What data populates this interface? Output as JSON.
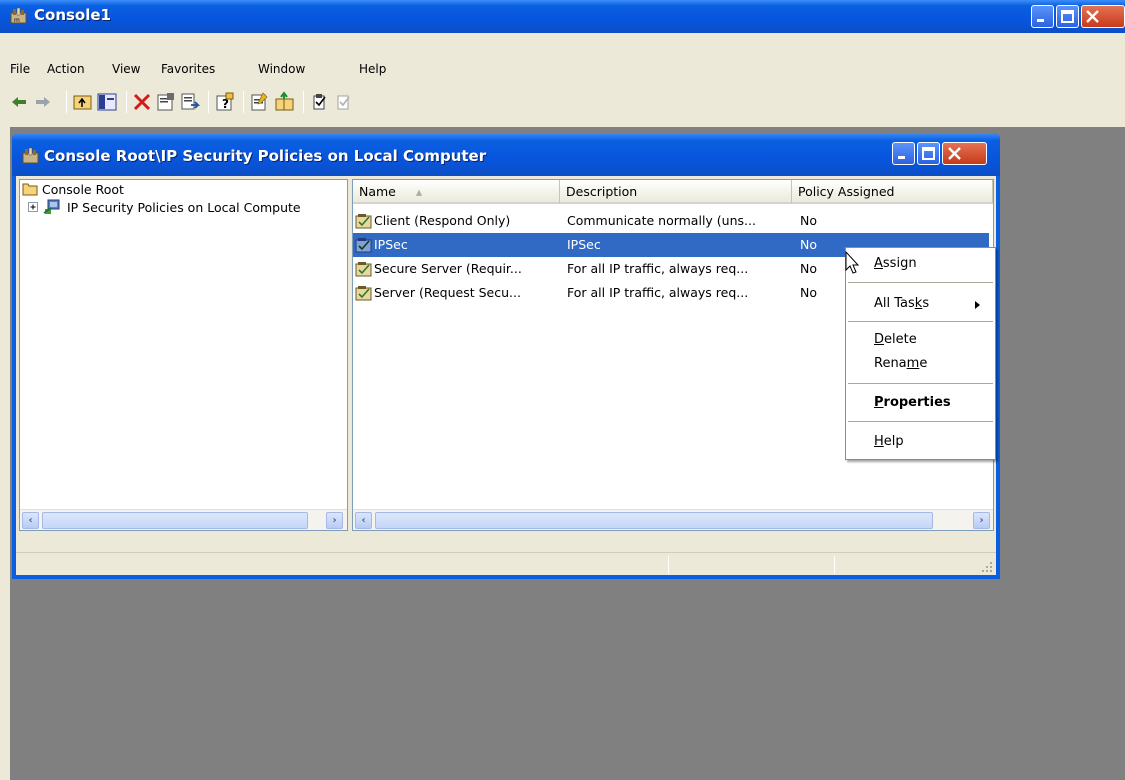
{
  "outer_window": {
    "title": "Console1"
  },
  "menubar": [
    "File",
    "Action",
    "View",
    "Favorites",
    "Window",
    "Help"
  ],
  "toolbar": {
    "icons": [
      "back-icon",
      "forward-icon",
      "up-folder-icon",
      "show-hide-tree-icon",
      "delete-icon",
      "properties-icon",
      "export-list-icon",
      "help-icon",
      "create-policy-icon",
      "manage-filters-icon",
      "assign-icon",
      "unassign-icon"
    ]
  },
  "inner_window": {
    "title": "Console Root\\IP Security Policies on Local Computer",
    "tree": {
      "root": "Console Root",
      "child": "IP Security Policies on Local Compute"
    },
    "columns": [
      "Name",
      "Description",
      "Policy Assigned"
    ],
    "rows": [
      {
        "name": "Client (Respond Only)",
        "description": "Communicate normally (uns...",
        "assigned": "No",
        "selected": false
      },
      {
        "name": "IPSec",
        "description": "IPSec",
        "assigned": "No",
        "selected": true
      },
      {
        "name": "Secure Server (Requir...",
        "description": "For all IP traffic, always req...",
        "assigned": "No",
        "selected": false
      },
      {
        "name": "Server (Request Secu...",
        "description": "For all IP traffic, always req...",
        "assigned": "No",
        "selected": false
      }
    ]
  },
  "context_menu": {
    "assign": {
      "pre": "",
      "key": "A",
      "post": "ssign"
    },
    "all_tasks": {
      "pre": "All Tas",
      "key": "k",
      "post": "s"
    },
    "delete": {
      "pre": "",
      "key": "D",
      "post": "elete"
    },
    "rename": {
      "pre": "Rena",
      "key": "m",
      "post": "e"
    },
    "properties": {
      "pre": "",
      "key": "P",
      "post": "roperties"
    },
    "help": {
      "pre": "",
      "key": "H",
      "post": "elp"
    }
  },
  "colors": {
    "title_blue": "#0a5fe0",
    "selection": "#316ac5",
    "mdi_background": "#808080",
    "close_red": "#c63a1a"
  }
}
